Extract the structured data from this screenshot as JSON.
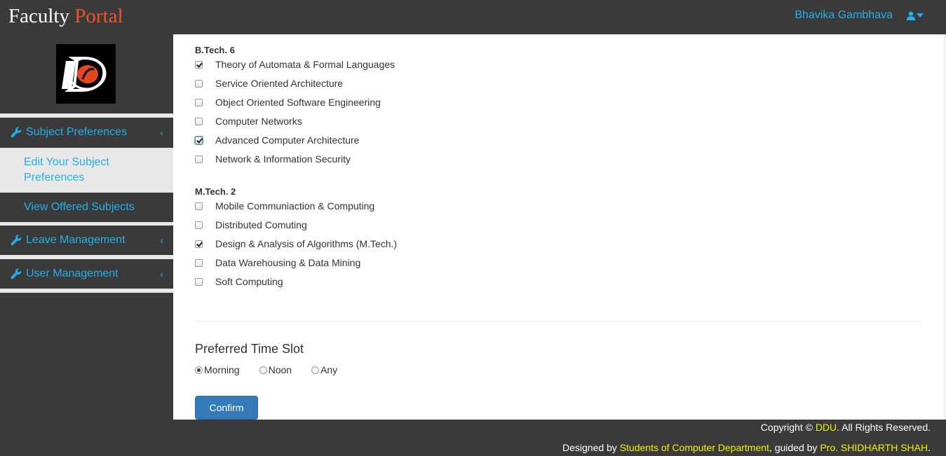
{
  "brand": {
    "part1": "Faculty ",
    "part2": "Portal"
  },
  "user": {
    "name": "Bhavika Gambhava",
    "icon": "user-icon"
  },
  "sidebar": {
    "logo_icon": "ddu-logo",
    "items": [
      {
        "label": "Subject Preferences",
        "icon": "wrench-icon",
        "expanded": true
      },
      {
        "label": "Leave Management",
        "icon": "wrench-icon"
      },
      {
        "label": "User Management",
        "icon": "wrench-icon"
      }
    ],
    "subitems": [
      {
        "label": "Edit Your Subject Preferences",
        "active": true
      },
      {
        "label": "View Offered Subjects"
      }
    ]
  },
  "groups": [
    {
      "title": "B.Tech. 6",
      "subjects": [
        {
          "label": "Theory of Automata & Formal Languages",
          "checked": true
        },
        {
          "label": "Service Oriented Architecture",
          "checked": false
        },
        {
          "label": "Object Oriented Software Engineering",
          "checked": false
        },
        {
          "label": "Computer Networks",
          "checked": false
        },
        {
          "label": "Advanced Computer Architecture",
          "checked": true
        },
        {
          "label": "Network & Information Security",
          "checked": false
        }
      ]
    },
    {
      "title": "M.Tech. 2",
      "subjects": [
        {
          "label": "Mobile Communiaction & Computing",
          "checked": false
        },
        {
          "label": "Distributed Comuting",
          "checked": false
        },
        {
          "label": "Design & Analysis of Algorithms (M.Tech.)",
          "checked": true
        },
        {
          "label": "Data Warehousing & Data Mining",
          "checked": false
        },
        {
          "label": "Soft Computing",
          "checked": false
        }
      ]
    }
  ],
  "time_slot": {
    "title": "Preferred Time Slot",
    "options": [
      {
        "label": "Morning",
        "selected": true
      },
      {
        "label": "Noon",
        "selected": false
      },
      {
        "label": "Any",
        "selected": false
      }
    ]
  },
  "confirm_label": "Confirm",
  "footer": {
    "copyright_prefix": "Copyright ©",
    "org": "DDU",
    "rights": ". All Rights Reserved.",
    "designed_by": "Designed by ",
    "students": "Students of Computer Department",
    "guided_by": ", guided by ",
    "guide": "Pro. SHIDHARTH SHAH",
    "end": "."
  },
  "colors": {
    "accent": "#21b0ea",
    "brand_orange": "#f0532a",
    "dark": "#3a3a3a",
    "button": "#337ab7",
    "footer_link": "#f2f200"
  }
}
